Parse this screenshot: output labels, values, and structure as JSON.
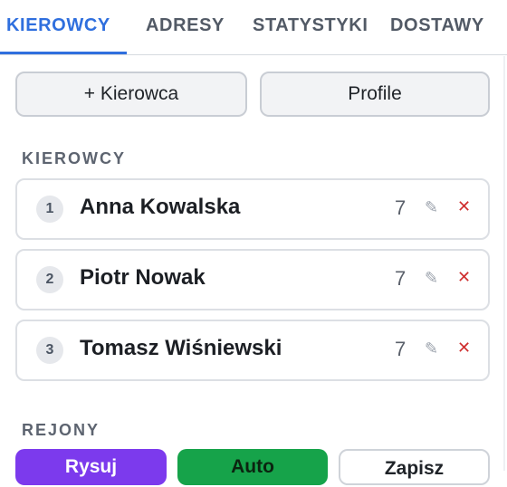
{
  "tabs": [
    "KIEROWCY",
    "ADRESY",
    "STATYSTYKI",
    "DOSTAWY"
  ],
  "actions": {
    "add_driver": "+ Kierowca",
    "profiles": "Profile"
  },
  "drivers_section": "KIEROWCY",
  "drivers": [
    {
      "num": "1",
      "name": "Anna Kowalska",
      "count": "7",
      "edit": "✎",
      "delete": "✕"
    },
    {
      "num": "2",
      "name": "Piotr Nowak",
      "count": "7",
      "edit": "✎",
      "delete": "✕"
    },
    {
      "num": "3",
      "name": "Tomasz Wiśniewski",
      "count": "7",
      "edit": "✎",
      "delete": "✕"
    }
  ],
  "regions_section": "REJONY",
  "region_buttons": [
    {
      "label": "Rysuj",
      "color": "#7c3aed"
    },
    {
      "label": "Auto",
      "color": "#16a34a"
    },
    {
      "label": "Zapisz",
      "color": "#ffffff"
    }
  ],
  "colors": {
    "accent": "#2f6fde",
    "delete": "#cf2e2e"
  }
}
